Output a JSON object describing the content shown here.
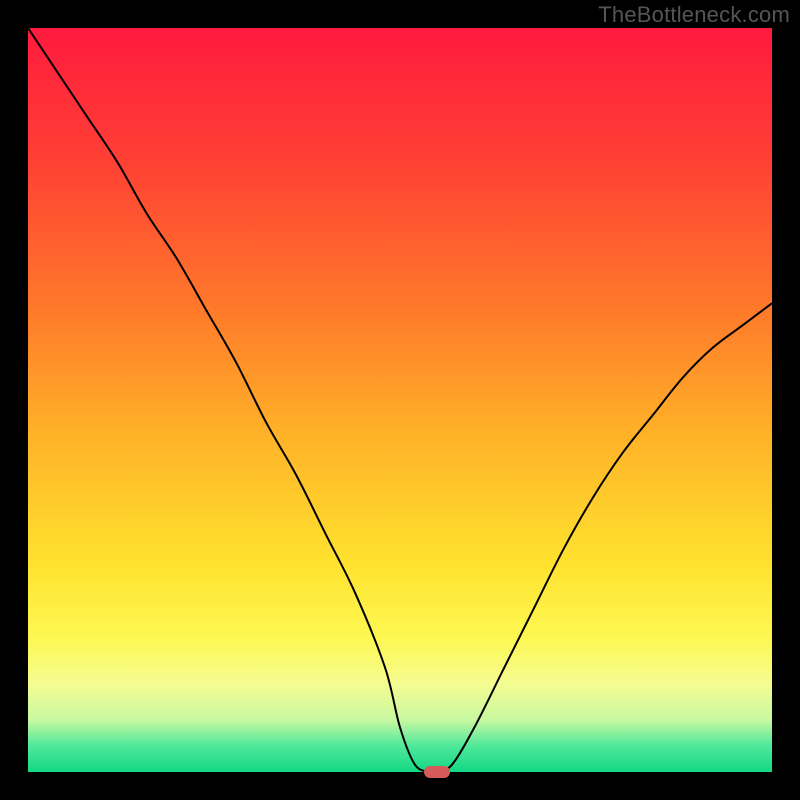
{
  "watermark": "TheBottleneck.com",
  "colors": {
    "frame": "#000000",
    "gradient_stops": [
      {
        "offset": 0.0,
        "color": "#ff1a3e"
      },
      {
        "offset": 0.18,
        "color": "#ff4034"
      },
      {
        "offset": 0.38,
        "color": "#ff7a2a"
      },
      {
        "offset": 0.55,
        "color": "#ffb328"
      },
      {
        "offset": 0.72,
        "color": "#ffe22e"
      },
      {
        "offset": 0.82,
        "color": "#fdf852"
      },
      {
        "offset": 0.88,
        "color": "#f5fc90"
      },
      {
        "offset": 0.93,
        "color": "#c8f8a0"
      },
      {
        "offset": 0.965,
        "color": "#4fe89a"
      },
      {
        "offset": 1.0,
        "color": "#13d884"
      }
    ],
    "curve": "#000000",
    "marker": "#d65a5a"
  },
  "chart_data": {
    "type": "line",
    "title": "",
    "xlabel": "",
    "ylabel": "",
    "xlim": [
      0,
      100
    ],
    "ylim": [
      0,
      100
    ],
    "series": [
      {
        "name": "bottleneck-curve",
        "x": [
          0,
          4,
          8,
          12,
          16,
          20,
          24,
          28,
          32,
          36,
          40,
          44,
          48,
          50,
          52,
          54,
          55,
          57,
          60,
          64,
          68,
          72,
          76,
          80,
          84,
          88,
          92,
          96,
          100
        ],
        "y": [
          100,
          94,
          88,
          82,
          75,
          69,
          62,
          55,
          47,
          40,
          32,
          24,
          14,
          6,
          1,
          0,
          0,
          1,
          6,
          14,
          22,
          30,
          37,
          43,
          48,
          53,
          57,
          60,
          63
        ]
      }
    ],
    "marker": {
      "x": 55,
      "y": 0
    }
  }
}
